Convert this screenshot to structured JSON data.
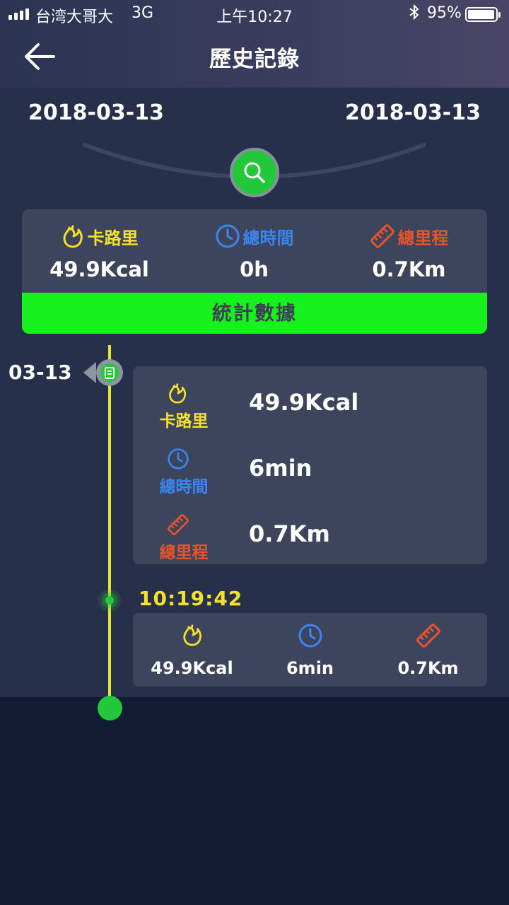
{
  "status_bar": {
    "carrier": "台湾大哥大",
    "network": "3G",
    "time": "上午10:27",
    "battery": "95%"
  },
  "nav": {
    "title": "歷史記錄",
    "back_icon": "arrow-left-icon"
  },
  "date_range": {
    "start": "2018-03-13",
    "end": "2018-03-13",
    "search_icon": "search-icon"
  },
  "summary": {
    "calories": {
      "label": "卡路里",
      "value": "49.9Kcal",
      "icon": "flame-icon",
      "color": "#f5e12a"
    },
    "duration": {
      "label": "總時間",
      "value": "0h",
      "icon": "clock-icon",
      "color": "#3a86f0"
    },
    "distance": {
      "label": "總里程",
      "value": "0.7Km",
      "icon": "ruler-icon",
      "color": "#e8532e"
    },
    "stats_label": "統計數據",
    "stats_color": "#18f21c"
  },
  "timeline": {
    "day": "03-13",
    "day_summary": {
      "calories": {
        "label": "卡路里",
        "value": "49.9Kcal"
      },
      "duration": {
        "label": "總時間",
        "value": "6min"
      },
      "distance": {
        "label": "總里程",
        "value": "0.7Km"
      }
    },
    "entries": [
      {
        "time": "10:19:42",
        "calories": "49.9Kcal",
        "duration": "6min",
        "distance": "0.7Km"
      }
    ]
  }
}
